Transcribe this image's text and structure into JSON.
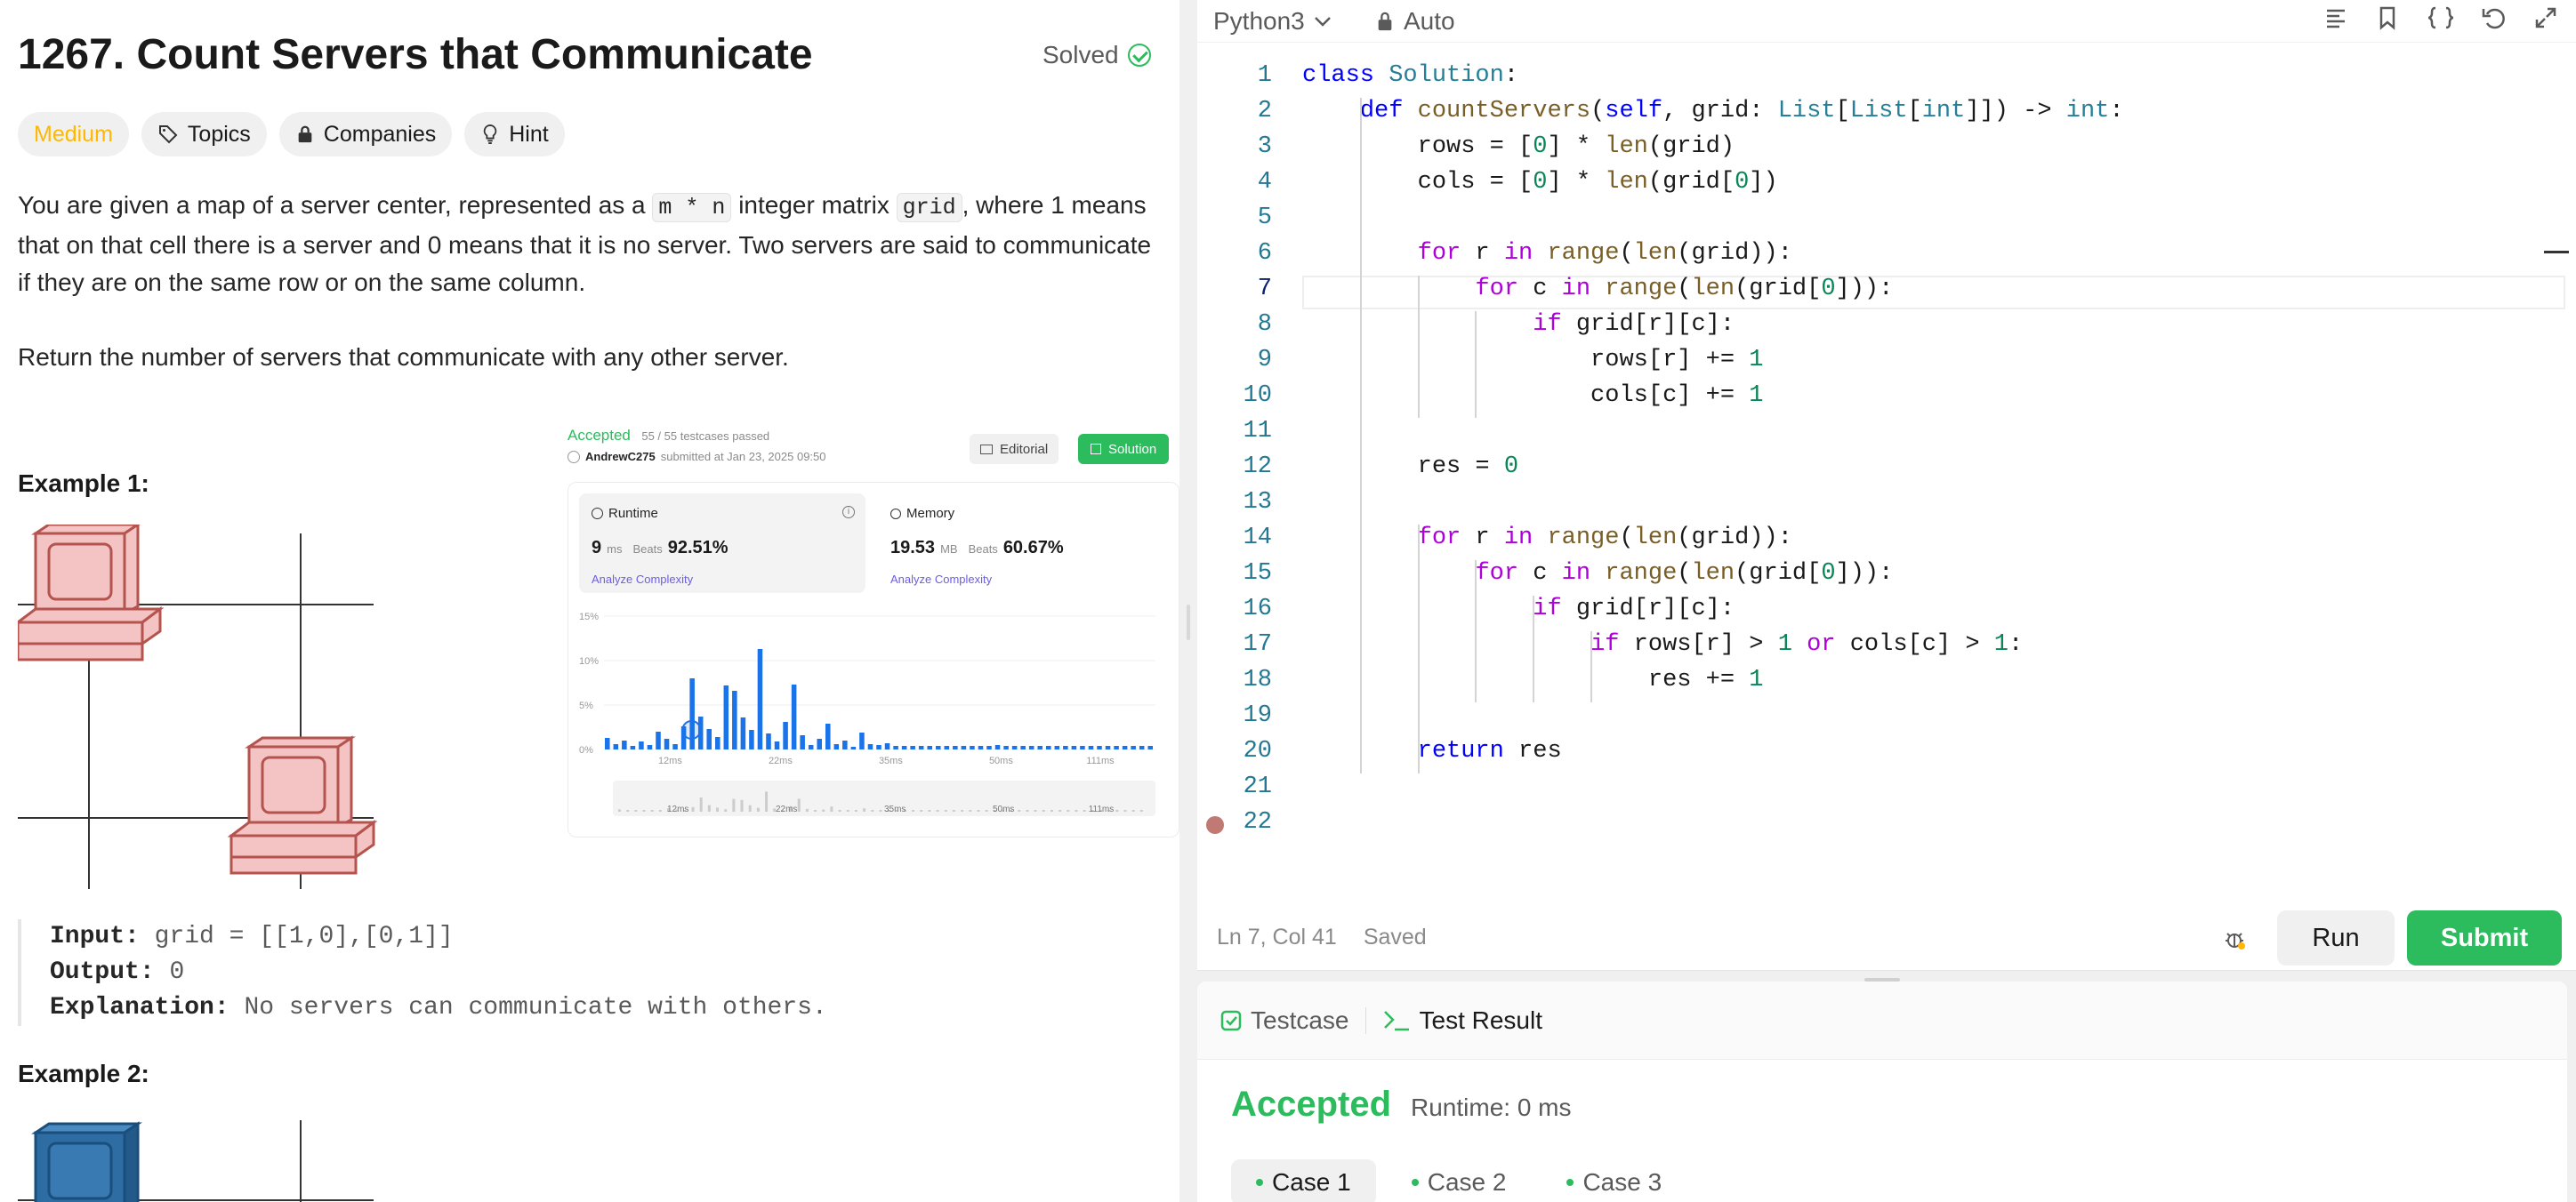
{
  "problem": {
    "title": "1267. Count Servers that Communicate",
    "status": "Solved",
    "tags": [
      "Medium",
      "Topics",
      "Companies",
      "Hint"
    ],
    "desc1_a": "You are given a map of a server center, represented as a ",
    "desc1_code1": "m * n",
    "desc1_b": " integer matrix ",
    "desc1_code2": "grid",
    "desc1_c": ", where 1 means that on that cell there is a server and 0 means that it is no server. Two servers are said to communicate if they are on the same row or on the same column.",
    "desc2": "Return the number of servers that communicate with any other server.",
    "example1_heading": "Example 1:",
    "example2_heading": "Example 2:",
    "input_label": "Input:",
    "input_value": "grid = [[1,0],[0,1]]",
    "output_label": "Output:",
    "output_value": "0",
    "explanation_label": "Explanation:",
    "explanation_value": "No servers can communicate with others."
  },
  "submission": {
    "status": "Accepted",
    "testcases": "55 / 55 testcases passed",
    "user": "AndrewC275",
    "submitted": "submitted at Jan 23, 2025 09:50",
    "editorial": "Editorial",
    "solution": "Solution",
    "runtime_label": "Runtime",
    "runtime_value": "9",
    "runtime_unit": "ms",
    "beats": "Beats",
    "runtime_beats": "92.51%",
    "memory_label": "Memory",
    "memory_value": "19.53",
    "memory_unit": "MB",
    "memory_beats": "60.67%",
    "analyze": "Analyze Complexity",
    "y_ticks": [
      "15%",
      "10%",
      "5%",
      "0%"
    ],
    "x_ticks": [
      "12ms",
      "22ms",
      "35ms",
      "50ms",
      "111ms"
    ],
    "bars": [
      1.3,
      0.6,
      1.0,
      0.4,
      0.9,
      0.5,
      2.0,
      1.2,
      0.6,
      2.6,
      8.0,
      3.7,
      2.3,
      1.4,
      7.2,
      6.6,
      3.6,
      2.2,
      11.3,
      1.8,
      0.9,
      3.1,
      7.3,
      1.6,
      0.5,
      1.2,
      2.9,
      0.6,
      1.0,
      0.3,
      1.9,
      0.6,
      0.5,
      0.7,
      0.4,
      0.4,
      0.4,
      0.4,
      0.4,
      0.4,
      0.4,
      0.4,
      0.4,
      0.4,
      0.4,
      0.4,
      0.5,
      0.4,
      0.4,
      0.4,
      0.4,
      0.4,
      0.4,
      0.4,
      0.4,
      0.4,
      0.4,
      0.4,
      0.4,
      0.4,
      0.4,
      0.4,
      0.4,
      0.4,
      0.4
    ]
  },
  "editor": {
    "language": "Python3",
    "auto": "Auto",
    "status_pos": "Ln 7, Col 41",
    "status_saved": "Saved",
    "run": "Run",
    "submit": "Submit"
  },
  "code_lines": [
    "class Solution:",
    "    def countServers(self, grid: List[List[int]]) -> int:",
    "        rows = [0] * len(grid)",
    "        cols = [0] * len(grid[0])",
    "",
    "        for r in range(len(grid)):",
    "            for c in range(len(grid[0])):",
    "                if grid[r][c]:",
    "                    rows[r] += 1",
    "                    cols[c] += 1",
    "",
    "        res = 0",
    "",
    "        for r in range(len(grid)):",
    "            for c in range(len(grid[0])):",
    "                if grid[r][c]:",
    "                    if rows[r] > 1 or cols[c] > 1:",
    "                        res += 1",
    "",
    "        return res",
    "",
    ""
  ],
  "results": {
    "tab_testcase": "Testcase",
    "tab_result": "Test Result",
    "status": "Accepted",
    "runtime": "Runtime: 0 ms",
    "cases": [
      "Case 1",
      "Case 2",
      "Case 3"
    ]
  },
  "colors": {
    "accent_green": "#2cbb5d",
    "medium": "#ffb800",
    "bar_blue": "#1a73e8"
  },
  "icons": [
    "check-circle-icon",
    "tag-icon",
    "lock-icon",
    "bulb-icon",
    "chevron-down-icon",
    "lock-icon",
    "list-icon",
    "bookmark-icon",
    "braces-icon",
    "undo-icon",
    "expand-icon",
    "debug-icon",
    "checkbox-icon",
    "terminal-icon"
  ]
}
